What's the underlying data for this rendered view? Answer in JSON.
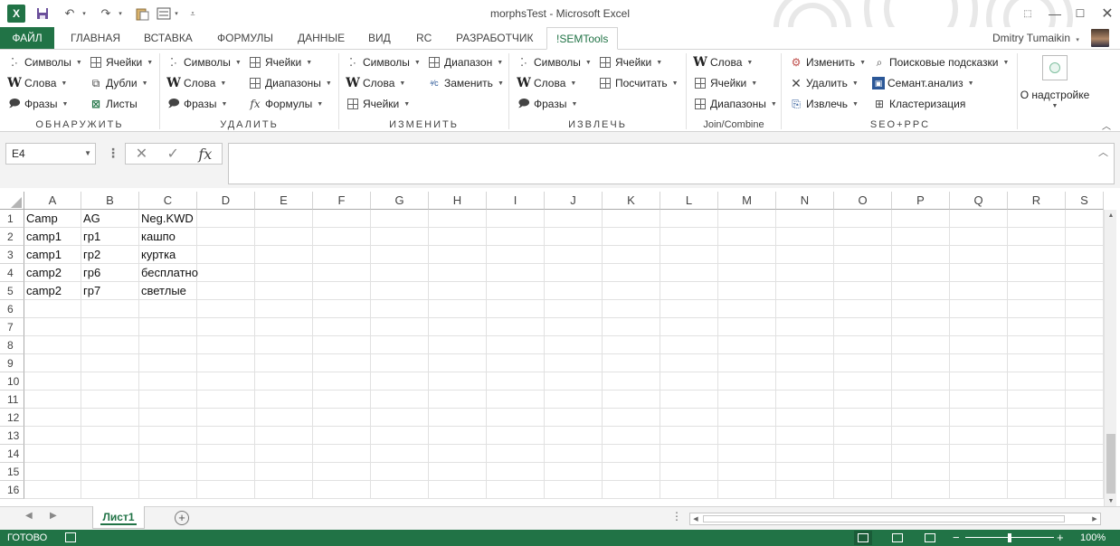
{
  "window": {
    "title": "morphsTest - Microsoft Excel",
    "user": "Dmitry Tumaikin",
    "logo_letter": "X"
  },
  "tabs": {
    "file": "ФАЙЛ",
    "items": [
      "ГЛАВНАЯ",
      "ВСТАВКА",
      "ФОРМУЛЫ",
      "ДАННЫЕ",
      "ВИД",
      "RC",
      "РАЗРАБОТЧИК",
      "!SEMTools"
    ],
    "active": "!SEMTools"
  },
  "ribbon": {
    "groups": [
      "ОБНАРУЖИТЬ",
      "УДАЛИТЬ",
      "ИЗМЕНИТЬ",
      "ИЗВЛЕЧЬ",
      "Join/Combine",
      "SEO+PPC"
    ],
    "find": {
      "symbols": "Символы",
      "words": "Слова",
      "phrases": "Фразы",
      "cells": "Ячейки",
      "dupes": "Дубли",
      "sheets": "Листы"
    },
    "remove": {
      "symbols": "Символы",
      "words": "Слова",
      "phrases": "Фразы",
      "cells": "Ячейки",
      "ranges": "Диапазоны",
      "formulas": "Формулы"
    },
    "change": {
      "symbols": "Символы",
      "words": "Слова",
      "cells": "Ячейки",
      "range": "Диапазон",
      "replace": "Заменить"
    },
    "extract": {
      "symbols": "Символы",
      "words": "Слова",
      "phrases": "Фразы",
      "cells": "Ячейки",
      "count": "Посчитать"
    },
    "join": {
      "words": "Слова",
      "cells": "Ячейки",
      "ranges": "Диапазоны"
    },
    "seo": {
      "change": "Изменить",
      "delete": "Удалить",
      "extract": "Извлечь",
      "suggest": "Поисковые подсказки",
      "semantic": "Семант.анализ",
      "cluster": "Кластеризация"
    },
    "addon": "О надстройке"
  },
  "formula": {
    "name_box": "E4",
    "content": ""
  },
  "grid": {
    "columns": [
      "A",
      "B",
      "C",
      "D",
      "E",
      "F",
      "G",
      "H",
      "I",
      "J",
      "K",
      "L",
      "M",
      "N",
      "O",
      "P",
      "Q",
      "R",
      "S"
    ],
    "rows": [
      "1",
      "2",
      "3",
      "4",
      "5",
      "6",
      "7",
      "8",
      "9",
      "10",
      "11",
      "12",
      "13",
      "14",
      "15",
      "16"
    ],
    "cells": [
      [
        "Camp",
        "AG",
        "Neg.KWD"
      ],
      [
        "camp1",
        "гр1",
        "кашпо"
      ],
      [
        "camp1",
        "гр2",
        "куртка"
      ],
      [
        "camp2",
        "гр6",
        "бесплатно"
      ],
      [
        "camp2",
        "гр7",
        "светлые"
      ]
    ]
  },
  "sheets": {
    "active": "Лист1"
  },
  "status": {
    "ready": "ГОТОВО",
    "zoom": "100%",
    "zoom_fraction": 0.5
  },
  "colors": {
    "accent": "#217346",
    "status_bg": "#217346"
  }
}
